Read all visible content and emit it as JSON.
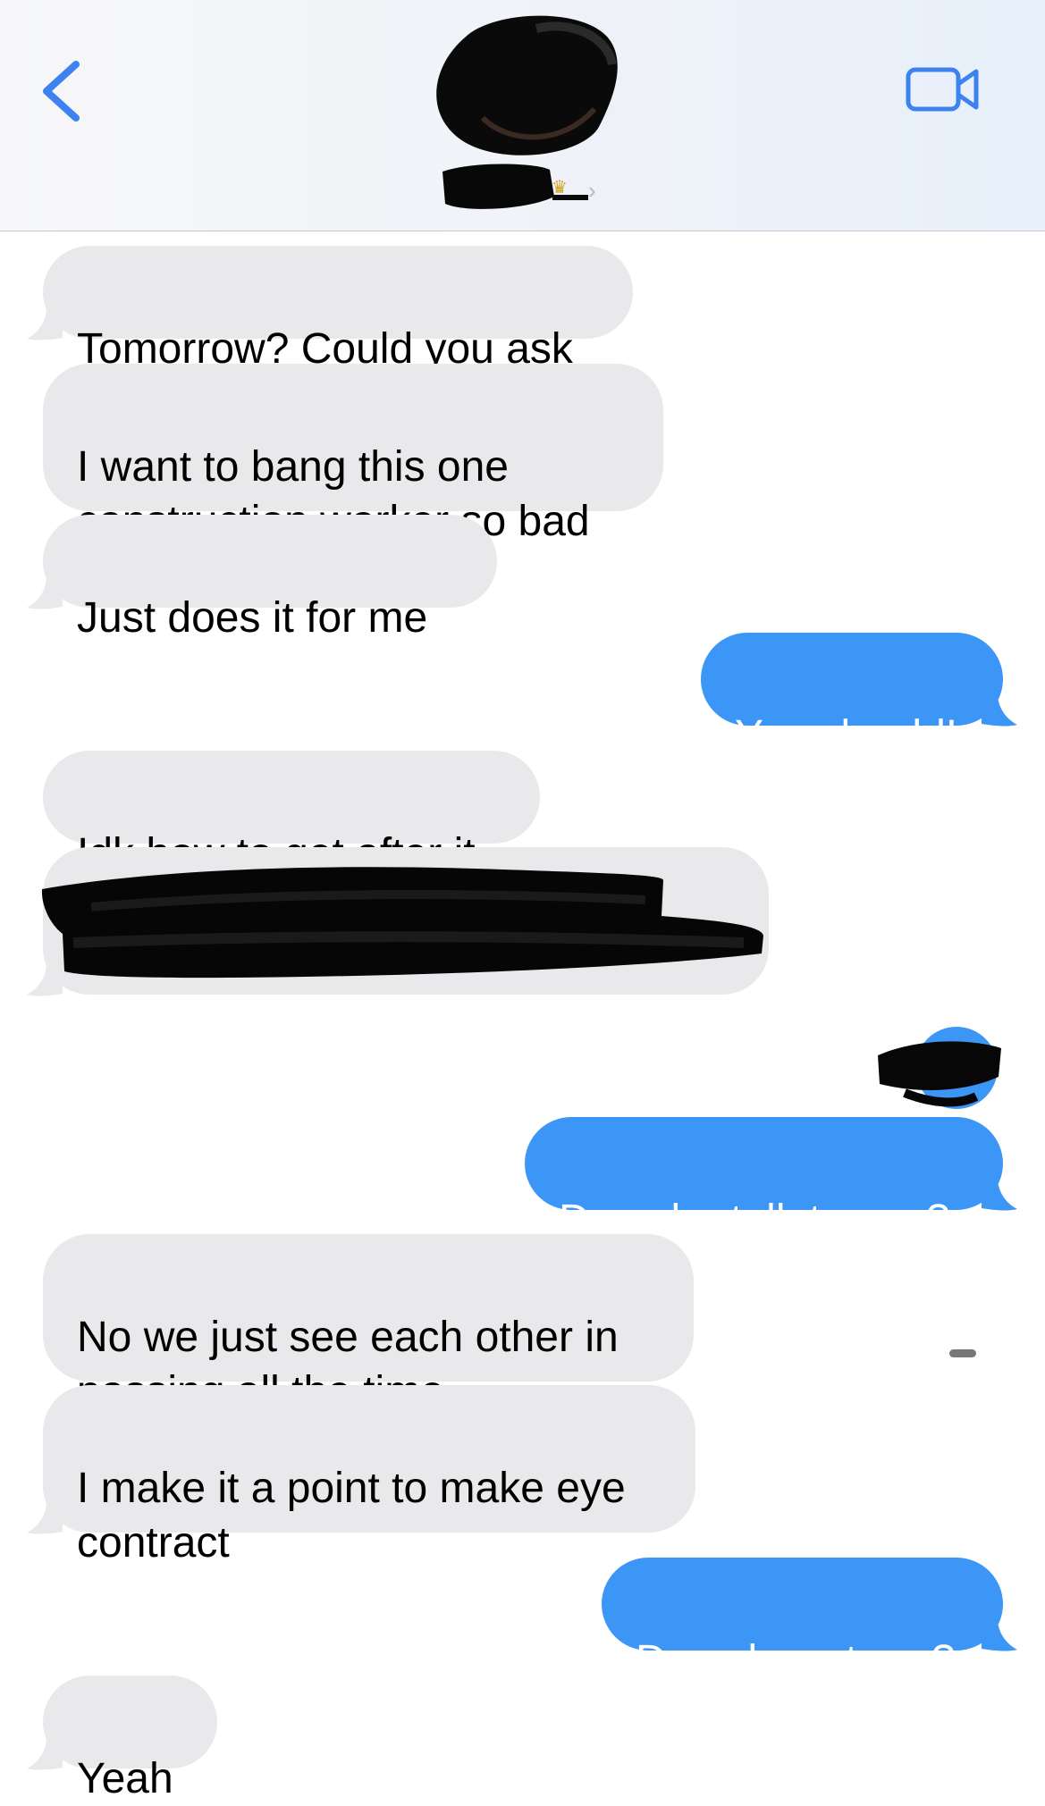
{
  "header": {
    "back_icon": "chevron-left-icon",
    "video_icon": "video-camera-icon",
    "contact_name": "",
    "accent_color": "#3c96f5"
  },
  "messages": [
    {
      "id": "m1",
      "direction": "incoming",
      "text": "Tomorrow? Could you ask"
    },
    {
      "id": "m2",
      "direction": "incoming",
      "text": "I want to bang this one\nconstruction worker so bad"
    },
    {
      "id": "m3",
      "direction": "incoming",
      "text": "Just does it for me"
    },
    {
      "id": "m4",
      "direction": "outgoing",
      "text": "You should!"
    },
    {
      "id": "m5",
      "direction": "incoming",
      "text": "Idk how to get after it"
    },
    {
      "id": "m6",
      "direction": "incoming",
      "text": ""
    },
    {
      "id": "m7",
      "direction": "outgoing",
      "text": "Does he talk to you?"
    },
    {
      "id": "m8",
      "direction": "incoming",
      "text": "No we just see each other in\npassing all the time"
    },
    {
      "id": "m9",
      "direction": "incoming",
      "text": "I make it a point to make eye\ncontract"
    },
    {
      "id": "m10",
      "direction": "outgoing",
      "text": "Does he return ?"
    },
    {
      "id": "m11",
      "direction": "incoming",
      "text": "Yeah"
    }
  ],
  "colors": {
    "incoming_bubble": "#e9e9eb",
    "outgoing_bubble": "#3c96f5"
  }
}
